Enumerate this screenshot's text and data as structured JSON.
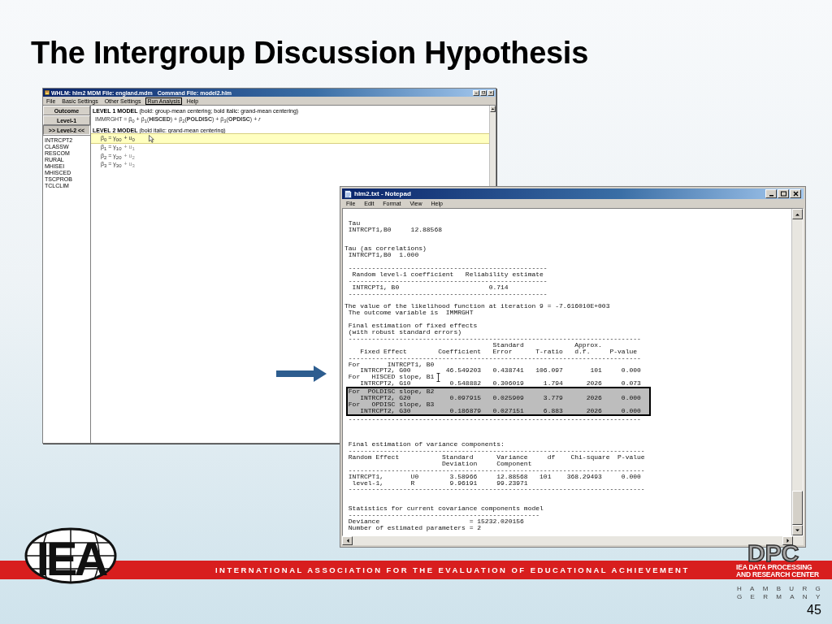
{
  "slide": {
    "title": "The Intergroup Discussion Hypothesis",
    "page_number": "45"
  },
  "hlm_window": {
    "title": "WHLM: hlm2 MDM File: england.mdm   Command File: model2.hlm",
    "menu": [
      {
        "label": "File",
        "highlighted": false
      },
      {
        "label": "Basic Settings",
        "highlighted": false
      },
      {
        "label": "Other Settings",
        "highlighted": false
      },
      {
        "label": "Run Analysis",
        "highlighted": true
      },
      {
        "label": "Help",
        "highlighted": false
      }
    ],
    "nav_buttons": [
      {
        "label": "Outcome",
        "selected": false
      },
      {
        "label": "Level-1",
        "selected": false
      },
      {
        "label": ">> Level-2 <<",
        "selected": true
      }
    ],
    "variables": [
      "INTRCPT2",
      "CLASSW",
      "RESCOM",
      "RURAL",
      "MHISEI",
      "MHISCED",
      "TSCPROB",
      "TCLCLIM"
    ],
    "level1_heading": "**LEVEL 1 MODEL** (bold: group-mean centering; bold italic: grand-mean centering)",
    "level1_equation": "IMMRGHT = β$_{0}$ + β$_{1}$(**HISCED**) + β$_{2}$(**POLDISC**) + β$_{3}$(**OPDISC**) + *r*",
    "level2_heading": "**LEVEL 2 MODEL** (bold italic: grand-mean centering)",
    "level2_equations": [
      {
        "equation": "β$_{0}$ = γ$_{00}$",
        "random_term": "+ u$_{0}$",
        "random_active": true,
        "selected": true
      },
      {
        "equation": "β$_{1}$ = γ$_{10}$",
        "random_term": "+ u$_{1}$",
        "random_active": false,
        "selected": false
      },
      {
        "equation": "β$_{2}$ = γ$_{20}$",
        "random_term": "+ u$_{2}$",
        "random_active": false,
        "selected": false
      },
      {
        "equation": "β$_{3}$ = γ$_{30}$",
        "random_term": "+ u$_{3}$",
        "random_active": false,
        "selected": false
      }
    ]
  },
  "notepad_window": {
    "title": "hlm2.txt - Notepad",
    "menu": [
      "File",
      "Edit",
      "Format",
      "View",
      "Help"
    ],
    "blocks": [
      {
        "highlighted": false,
        "lines": [
          " Tau",
          " INTRCPT1,B0     12.88568"
        ]
      },
      {
        "highlighted": false,
        "lines": [
          "Tau (as correlations)",
          " INTRCPT1,B0  1.000"
        ]
      },
      {
        "highlighted": false,
        "lines": [
          " ---------------------------------------------------",
          "  Random level-1 coefficient   Reliability estimate",
          " ---------------------------------------------------",
          "  INTRCPT1, B0                       0.714",
          " ---------------------------------------------------"
        ]
      },
      {
        "highlighted": false,
        "lines": [
          "The value of the likelihood function at iteration 9 = -7.616010E+003",
          " The outcome variable is  IMMRGHT"
        ]
      },
      {
        "highlighted": false,
        "lines": [
          " Final estimation of fixed effects",
          " (with robust standard errors)",
          " ---------------------------------------------------------------------------",
          "                                      Standard             Approx.",
          "    Fixed Effect        Coefficient   Error      T-ratio   d.f.     P-value",
          " ---------------------------------------------------------------------------",
          " For       INTRCPT1, B0",
          "    INTRCPT2, G00         46.549203   0.438741   106.097       101     0.000",
          " For   HISCED slope, B1",
          "    INTRCPT2, G10          0.548882   0.306019     1.794      2026     0.073"
        ]
      },
      {
        "highlighted": true,
        "lines": [
          " For  POLDISC slope, B2",
          "    INTRCPT2, G20          0.097915   0.025909     3.779      2026     0.000",
          " For   OPDISC slope, B3",
          "    INTRCPT2, G30          0.186879   0.027151     6.883      2026     0.000"
        ]
      },
      {
        "highlighted": false,
        "lines": [
          " ---------------------------------------------------------------------------"
        ]
      },
      {
        "highlighted": false,
        "lines": [
          " Final estimation of variance components:",
          " ----------------------------------------------------------------------------",
          " Random Effect           Standard      Variance     df    Chi-square  P-value",
          "                         Deviation     Component",
          " ----------------------------------------------------------------------------",
          " INTRCPT1,       U0        3.58966     12.88568   101    368.29493     0.000",
          "  level-1,       R         9.96191     99.23971",
          " ----------------------------------------------------------------------------"
        ]
      },
      {
        "highlighted": false,
        "lines": [
          " Statistics for current covariance components model",
          " -------------------------------------------------",
          " Deviance                       = 15232.020156",
          " Number of estimated parameters = 2"
        ]
      }
    ]
  },
  "footer": {
    "banner": "INTERNATIONAL ASSOCIATION FOR THE EVALUATION OF EDUCATIONAL ACHIEVEMENT",
    "left_logo": "IEA",
    "right_logo": "DPC",
    "center_line_1": "IEA DATA PROCESSING",
    "center_line_2": "AND RESEARCH CENTER",
    "city": "HAMBURG",
    "country": "GERMANY"
  }
}
